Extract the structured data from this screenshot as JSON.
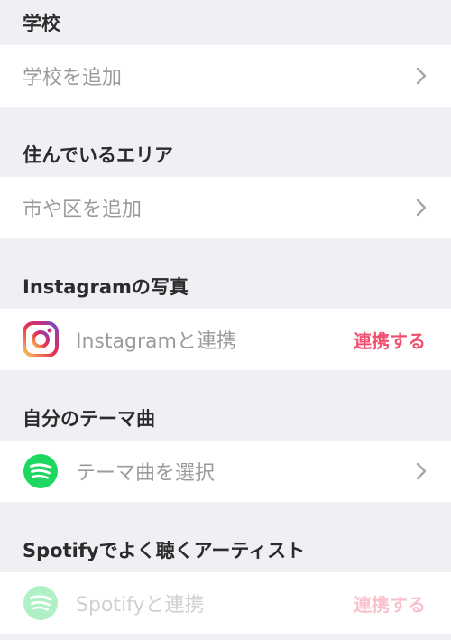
{
  "sections": {
    "school": {
      "header": "学校",
      "row_label": "学校を追加",
      "chevron_icon": "chevron-right-icon"
    },
    "area": {
      "header": "住んでいるエリア",
      "row_label": "市や区を追加",
      "chevron_icon": "chevron-right-icon"
    },
    "instagram": {
      "header": "Instagramの写真",
      "row_label": "Instagramと連携",
      "action_label": "連携する",
      "icon": "instagram-icon"
    },
    "anthem": {
      "header": "自分のテーマ曲",
      "row_label": "テーマ曲を選択",
      "icon": "spotify-icon",
      "chevron_icon": "chevron-right-icon"
    },
    "spotify_artists": {
      "header": "Spotifyでよく聴くアーティスト",
      "row_label": "Spotifyと連携",
      "action_label": "連携する",
      "icon": "spotify-icon"
    }
  },
  "colors": {
    "background": "#efeff4",
    "row_background": "#ffffff",
    "header_text": "#2b2b2b",
    "row_text": "#9b9b9b",
    "accent": "#f0506e",
    "spotify_green": "#1ed760"
  }
}
